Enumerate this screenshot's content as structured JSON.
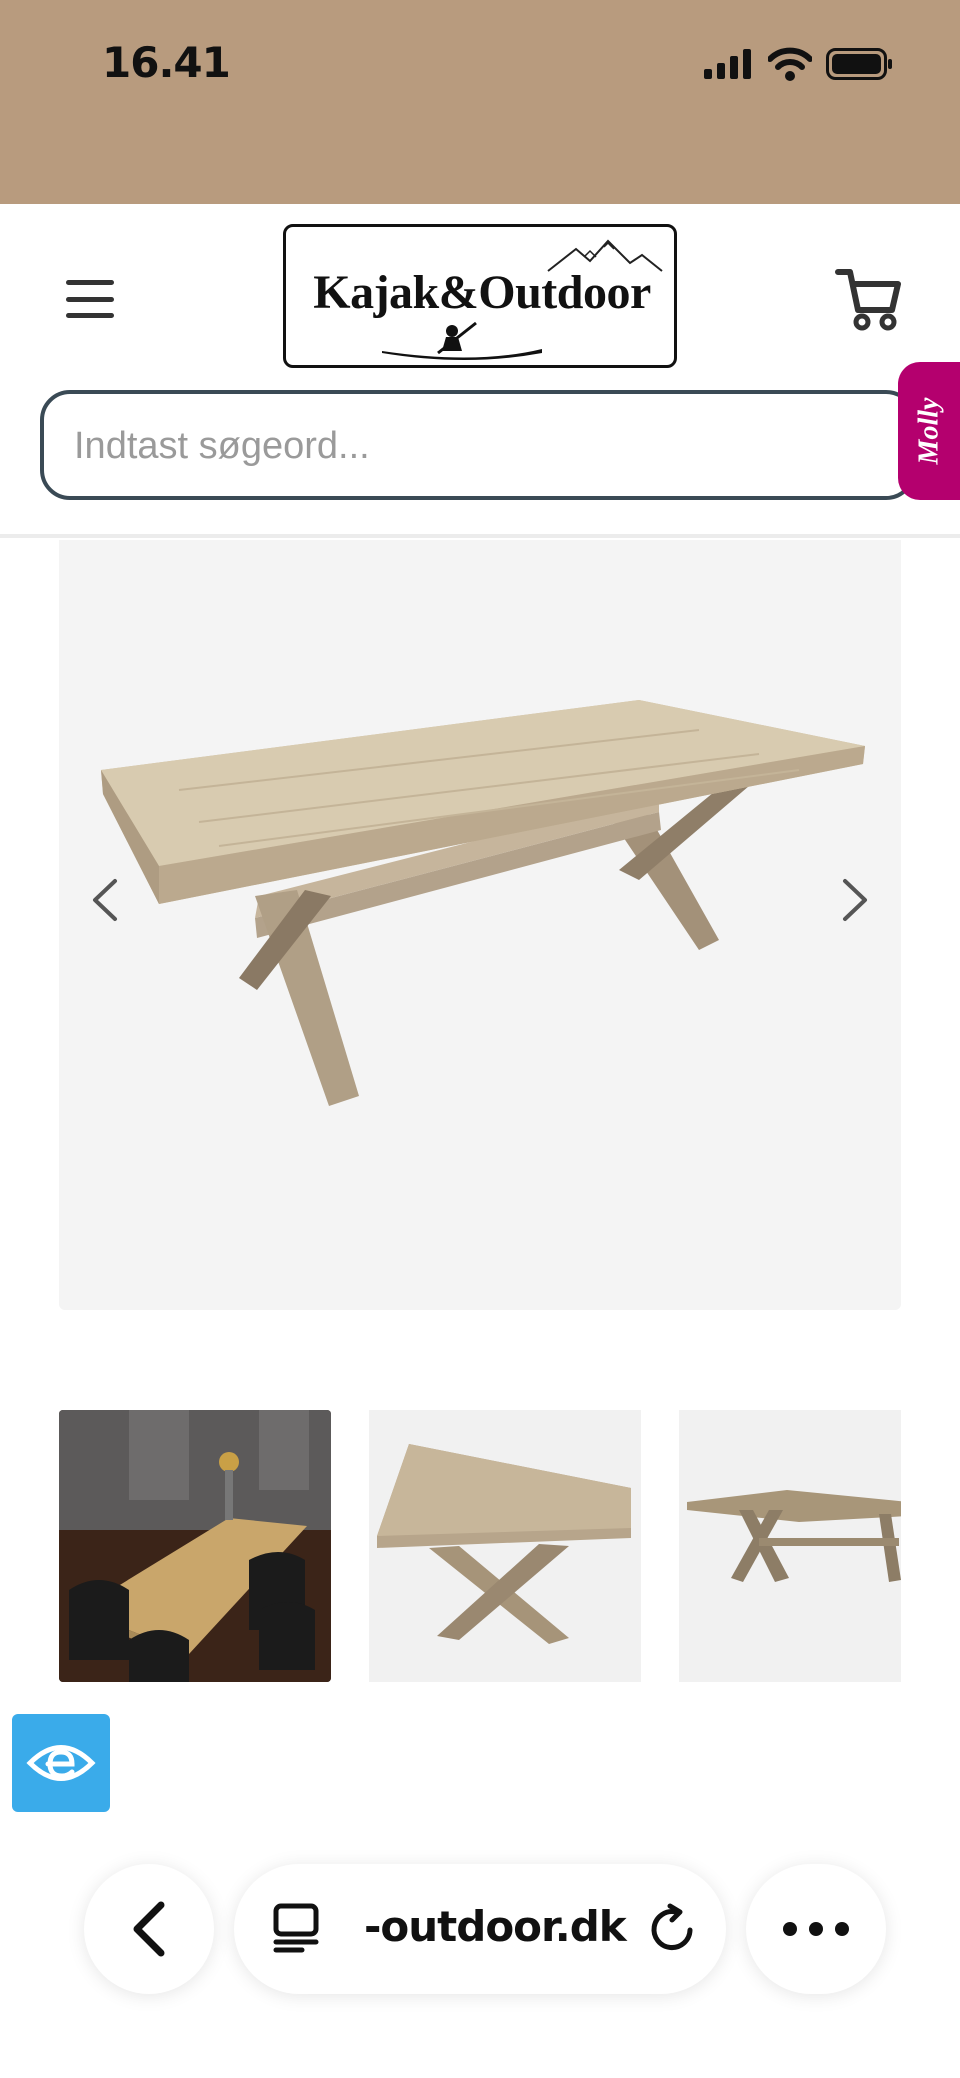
{
  "status_bar": {
    "time": "16.41",
    "icons": [
      "cellular-signal-icon",
      "wifi-icon",
      "battery-icon"
    ]
  },
  "header": {
    "menu_icon": "hamburger-menu-icon",
    "logo": {
      "text": "Kajak&Outdoor",
      "icon": "kayaker-mountains-logo"
    },
    "cart_icon": "shopping-cart-icon"
  },
  "search": {
    "placeholder": "Indtast søgeord...",
    "value": ""
  },
  "molly_tab": {
    "label": "Molly"
  },
  "gallery": {
    "main_image": "dining-table-x-legs-photo",
    "prev_icon": "chevron-left-icon",
    "next_icon": "chevron-right-icon",
    "thumbnails": [
      {
        "name": "table-with-chairs-photo"
      },
      {
        "name": "table-top-angle-photo"
      },
      {
        "name": "table-side-photo"
      }
    ]
  },
  "accessibility": {
    "icon": "eye-accessibility-icon"
  },
  "browser": {
    "back_icon": "chevron-left-icon",
    "tabs_icon": "tabs-icon",
    "url": "-outdoor.dk",
    "reload_icon": "reload-icon",
    "more_icon": "more-dots-icon"
  },
  "colors": {
    "status_bar_bg": "#b89b7e",
    "search_border": "#3a4a55",
    "molly_tab": "#b4006e",
    "accessibility": "#3aabea"
  }
}
